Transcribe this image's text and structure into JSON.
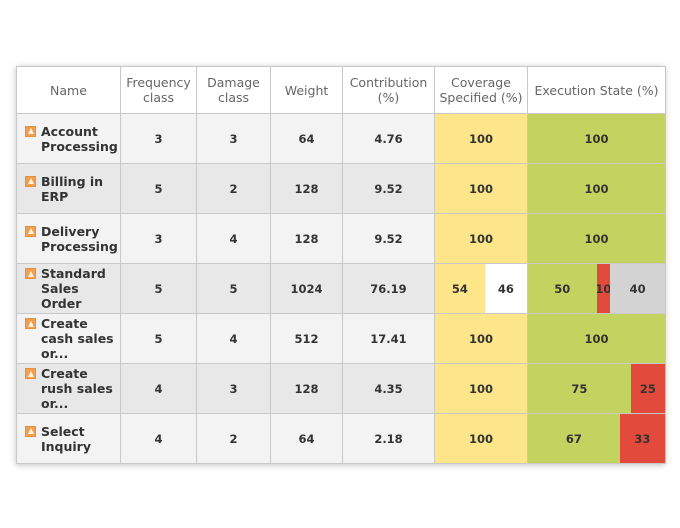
{
  "colors": {
    "coverage_specified": "#fde68a",
    "coverage_unspecified": "#ffffff",
    "executed_ok": "#c3d35f",
    "executed_failed": "#e24a3b",
    "not_executed": "#d3d3d3"
  },
  "headers": {
    "name": "Name",
    "frequency": "Frequency class",
    "damage": "Damage class",
    "weight": "Weight",
    "contribution": "Contribution (%)",
    "coverage": "Coverage Specified (%)",
    "execution": "Execution State (%)"
  },
  "rows": [
    {
      "icon": "warning-icon",
      "name": "Account Processing",
      "frequency": "3",
      "damage": "3",
      "weight": "64",
      "contribution": "4.76",
      "coverage": [
        {
          "value": 100,
          "label": "100",
          "kind": "coverage_specified"
        }
      ],
      "execution": [
        {
          "value": 100,
          "label": "100",
          "kind": "executed_ok"
        }
      ]
    },
    {
      "icon": "warning-icon",
      "name": "Billing in ERP",
      "frequency": "5",
      "damage": "2",
      "weight": "128",
      "contribution": "9.52",
      "coverage": [
        {
          "value": 100,
          "label": "100",
          "kind": "coverage_specified"
        }
      ],
      "execution": [
        {
          "value": 100,
          "label": "100",
          "kind": "executed_ok"
        }
      ]
    },
    {
      "icon": "warning-icon",
      "name": "Delivery Processing",
      "frequency": "3",
      "damage": "4",
      "weight": "128",
      "contribution": "9.52",
      "coverage": [
        {
          "value": 100,
          "label": "100",
          "kind": "coverage_specified"
        }
      ],
      "execution": [
        {
          "value": 100,
          "label": "100",
          "kind": "executed_ok"
        }
      ]
    },
    {
      "icon": "warning-icon",
      "name": "Standard Sales Order",
      "frequency": "5",
      "damage": "5",
      "weight": "1024",
      "contribution": "76.19",
      "coverage": [
        {
          "value": 54,
          "label": "54",
          "kind": "coverage_specified"
        },
        {
          "value": 46,
          "label": "46",
          "kind": "coverage_unspecified"
        }
      ],
      "execution": [
        {
          "value": 50,
          "label": "50",
          "kind": "executed_ok"
        },
        {
          "value": 10,
          "label": "10",
          "kind": "executed_failed"
        },
        {
          "value": 40,
          "label": "40",
          "kind": "not_executed"
        }
      ]
    },
    {
      "icon": "warning-icon",
      "name": "Create cash sales or...",
      "frequency": "5",
      "damage": "4",
      "weight": "512",
      "contribution": "17.41",
      "coverage": [
        {
          "value": 100,
          "label": "100",
          "kind": "coverage_specified"
        }
      ],
      "execution": [
        {
          "value": 100,
          "label": "100",
          "kind": "executed_ok"
        }
      ]
    },
    {
      "icon": "warning-icon",
      "name": "Create rush sales or...",
      "frequency": "4",
      "damage": "3",
      "weight": "128",
      "contribution": "4.35",
      "coverage": [
        {
          "value": 100,
          "label": "100",
          "kind": "coverage_specified"
        }
      ],
      "execution": [
        {
          "value": 75,
          "label": "75",
          "kind": "executed_ok"
        },
        {
          "value": 25,
          "label": "25",
          "kind": "executed_failed"
        }
      ]
    },
    {
      "icon": "warning-icon",
      "name": "Select Inquiry",
      "frequency": "4",
      "damage": "2",
      "weight": "64",
      "contribution": "2.18",
      "coverage": [
        {
          "value": 100,
          "label": "100",
          "kind": "coverage_specified"
        }
      ],
      "execution": [
        {
          "value": 67,
          "label": "67",
          "kind": "executed_ok"
        },
        {
          "value": 33,
          "label": "33",
          "kind": "executed_failed"
        }
      ]
    }
  ]
}
